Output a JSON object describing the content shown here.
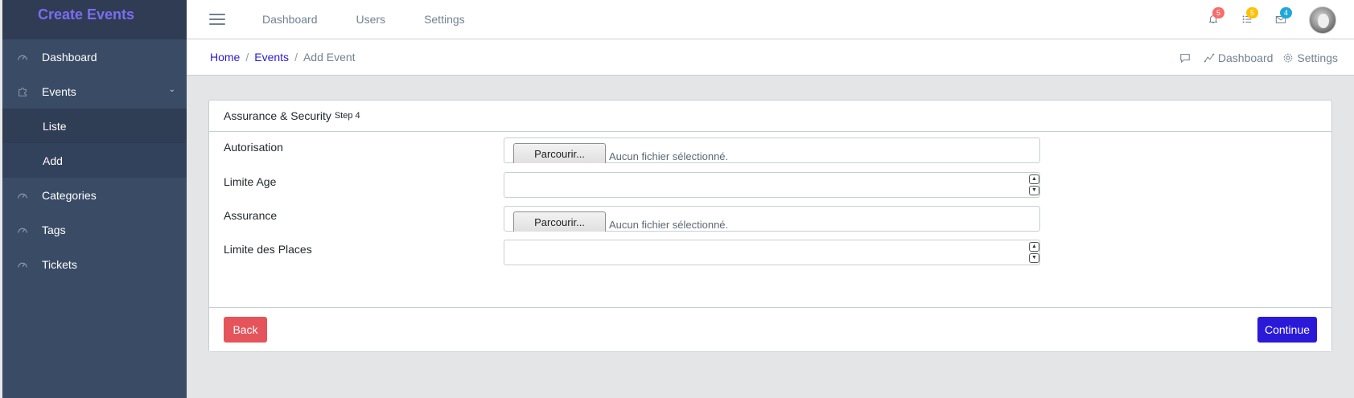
{
  "brand": "Create Events",
  "sidebar": {
    "items": [
      {
        "label": "Dashboard"
      },
      {
        "label": "Events"
      },
      {
        "label": "Liste"
      },
      {
        "label": "Add"
      },
      {
        "label": "Categories"
      },
      {
        "label": "Tags"
      },
      {
        "label": "Tickets"
      }
    ]
  },
  "header": {
    "links": [
      "Dashboard",
      "Users",
      "Settings"
    ],
    "badges": {
      "notifications": {
        "count": "5",
        "color": "#f86c6b"
      },
      "tasks": {
        "count": "5",
        "color": "#ffc107"
      },
      "messages": {
        "count": "4",
        "color": "#20a8d8"
      }
    }
  },
  "breadcrumb": {
    "home": "Home",
    "events": "Events",
    "current": "Add Event",
    "right": {
      "dashboard": "Dashboard",
      "settings": "Settings"
    }
  },
  "card": {
    "title": "Assurance & Security",
    "step": "Step 4",
    "fields": [
      {
        "label": "Autorisation",
        "button": "Parcourir...",
        "status": "Aucun fichier sélectionné."
      },
      {
        "label": "Limite Age",
        "value": ""
      },
      {
        "label": "Assurance",
        "button": "Parcourir...",
        "status": "Aucun fichier sélectionné."
      },
      {
        "label": "Limite des Places",
        "value": ""
      }
    ],
    "back_label": "Back",
    "continue_label": "Continue"
  },
  "colors": {
    "accent": "#2a1ad8",
    "danger": "#e5545a",
    "brand_text": "#7c6cf1",
    "sidebar_bg": "#3a4b66"
  }
}
